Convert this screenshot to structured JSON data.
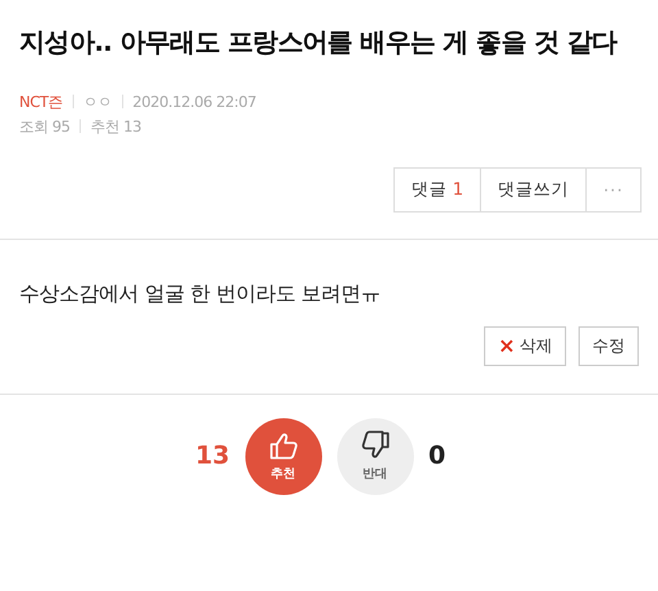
{
  "title": "지성아.. 아무래도 프랑스어를 배우는 게 좋을 것 같다",
  "meta": {
    "author": "NCT즌",
    "nickname": "ㅇㅇ",
    "date": "2020.12.06 22:07",
    "views": "조회 95",
    "recommends": "추천 13"
  },
  "actions": {
    "comments": {
      "label": "댓글",
      "count": "1"
    },
    "write": "댓글쓰기",
    "more": "···"
  },
  "body": "수상소감에서 얼굴 한 번이라도 보려면ㅠ",
  "edit_buttons": {
    "delete": {
      "icon": "×",
      "label": "삭제"
    },
    "edit": "수정"
  },
  "votes": {
    "up_count": "13",
    "up_label": "추천",
    "down_label": "반대",
    "down_count": "0"
  }
}
